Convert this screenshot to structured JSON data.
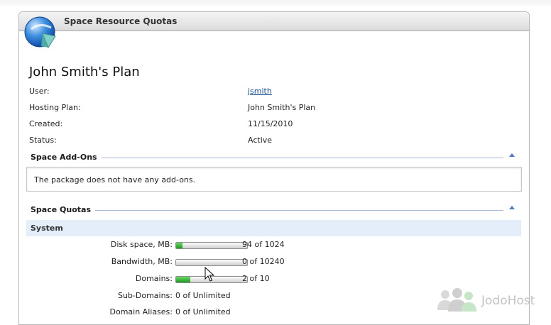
{
  "panel": {
    "title": "Space Resource Quotas"
  },
  "plan": {
    "title": "John Smith's Plan",
    "fields": [
      {
        "label": "User:",
        "value": "jsmith"
      },
      {
        "label": "Hosting Plan:",
        "value": "John Smith's Plan"
      },
      {
        "label": "Created:",
        "value": "11/15/2010"
      },
      {
        "label": "Status:",
        "value": "Active"
      }
    ]
  },
  "addons": {
    "title": "Space Add-Ons",
    "message": "The package does not have any add-ons."
  },
  "quotas": {
    "title": "Space Quotas",
    "group": "System",
    "items": [
      {
        "label": "Disk space, MB:",
        "value": "94 of 1024",
        "progress": 0.09
      },
      {
        "label": "Bandwidth, MB:",
        "value": "0 of 10240",
        "progress": 0.0
      },
      {
        "label": "Domains:",
        "value": "2 of 10",
        "progress": 0.2
      },
      {
        "label": "Sub-Domains:",
        "value": "0 of Unlimited"
      },
      {
        "label": "Domain Aliases:",
        "value": "0 of Unlimited"
      }
    ]
  },
  "watermark": {
    "text": "JodoHost"
  },
  "colors": {
    "accent": "#1c4f9c",
    "progress": "#2aa52a",
    "group_bg": "#e3eefa"
  }
}
